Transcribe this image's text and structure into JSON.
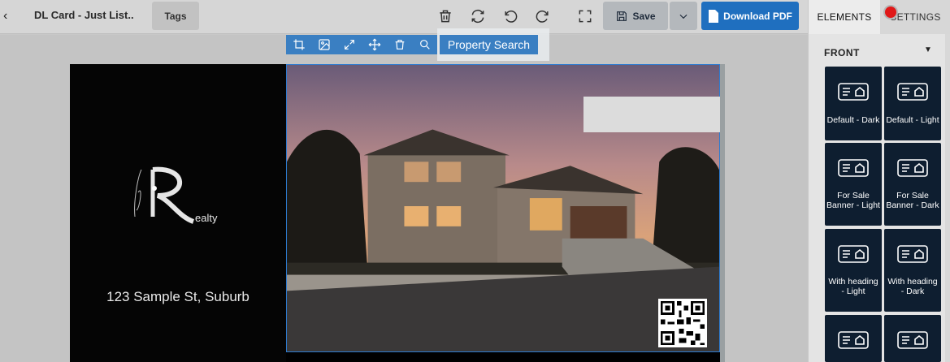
{
  "header": {
    "back_label": "‹",
    "title": "DL Card - Just List..",
    "tags_label": "Tags",
    "save_label": "Save",
    "download_label": "Download PDF",
    "icons": [
      "trash-icon",
      "sync-icon",
      "undo-icon",
      "redo-icon",
      "fullscreen-icon"
    ]
  },
  "image_toolbar": {
    "icons": [
      "crop-icon",
      "image-icon",
      "resize-icon",
      "move-icon",
      "trash-icon",
      "search-icon"
    ],
    "tooltip": "Property Search"
  },
  "card": {
    "brand_text": "ealty",
    "address": "123 Sample St, Suburb"
  },
  "panel": {
    "tabs": [
      "ELEMENTS",
      "SETTINGS"
    ],
    "section": "FRONT",
    "tiles": [
      {
        "label": "Default - Dark"
      },
      {
        "label": "Default - Light"
      },
      {
        "label": "For Sale Banner - Light"
      },
      {
        "label": "For Sale Banner - Dark"
      },
      {
        "label": "With heading - Light"
      },
      {
        "label": "With heading - Dark"
      },
      {
        "label": ""
      },
      {
        "label": ""
      }
    ]
  },
  "colors": {
    "accent": "#1f6fbf",
    "tile_bg": "#0e1e30",
    "record_dot": "#e01818"
  }
}
